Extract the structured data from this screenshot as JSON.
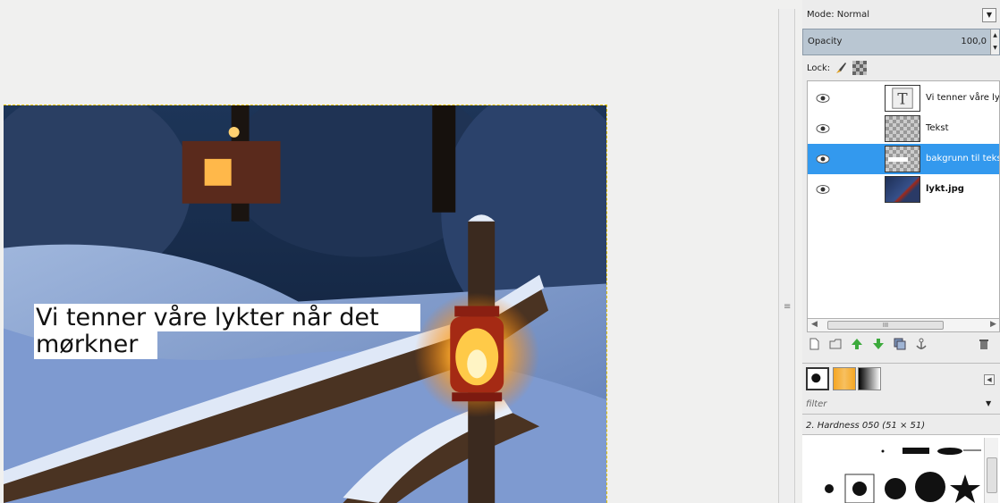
{
  "canvas": {
    "overlay_lines": [
      "Vi tenner våre lykter når det",
      "mørkner"
    ]
  },
  "panel": {
    "mode_label": "Mode: Normal",
    "opacity_label": "Opacity",
    "opacity_value": "100,0",
    "lock_label": "Lock:",
    "layers": [
      {
        "name": "Vi tenner våre lyk",
        "visible": true,
        "selected": false,
        "thumb": "text-icon"
      },
      {
        "name": "Tekst",
        "visible": true,
        "selected": false,
        "thumb": "transparent"
      },
      {
        "name": "bakgrunn til teks",
        "visible": true,
        "selected": true,
        "thumb": "transparent-strip"
      },
      {
        "name": "lykt.jpg",
        "visible": true,
        "selected": false,
        "thumb": "photo"
      }
    ],
    "scrollbar_grip": "III",
    "brush_filter_placeholder": "filter",
    "brush_name": "2. Hardness 050 (51 × 51)",
    "vgrip": "≡"
  },
  "colors": {
    "selection": "#3399ee",
    "accent_gold": "#f5a623"
  }
}
